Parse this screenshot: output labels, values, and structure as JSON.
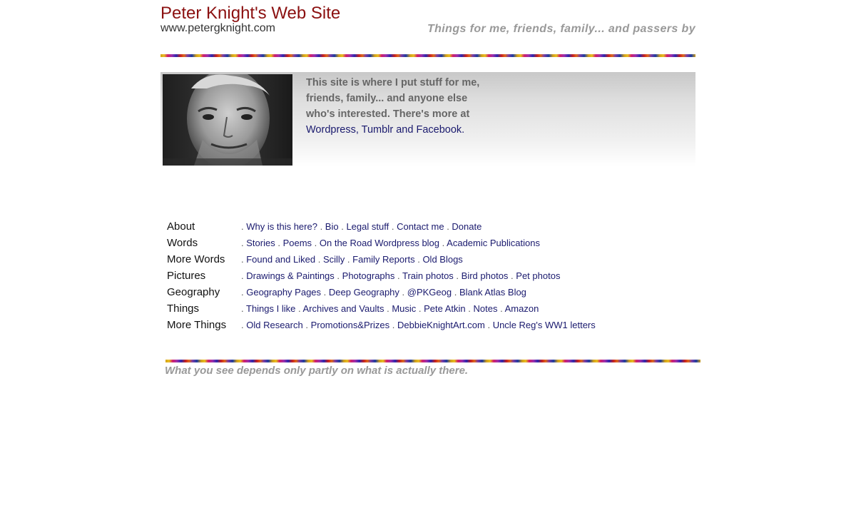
{
  "header": {
    "title": "Peter Knight's Web Site",
    "url": "www.petergknight.com",
    "tagline": "Things for me, friends, family... and passers by"
  },
  "intro": {
    "text": "This site is where I put stuff for me, friends, family... and anyone else who's interested. There's more at",
    "links": [
      "Wordpress",
      "Tumblr",
      "Facebook"
    ],
    "sep_comma": ", ",
    "sep_and": " and ",
    "end": "."
  },
  "nav": {
    "rows": [
      {
        "category": "About",
        "links": [
          "Why is this here?",
          "Bio",
          "Legal stuff",
          "Contact me",
          "Donate"
        ]
      },
      {
        "category": "Words",
        "links": [
          "Stories",
          "Poems",
          "On the Road Wordpress blog",
          "Academic Publications"
        ]
      },
      {
        "category": "More Words",
        "links": [
          "Found and Liked",
          "Scilly",
          "Family Reports",
          "Old Blogs"
        ]
      },
      {
        "category": "Pictures",
        "links": [
          "Drawings & Paintings",
          "Photographs",
          "Train photos",
          "Bird photos",
          "Pet photos"
        ]
      },
      {
        "category": "Geography",
        "links": [
          "Geography Pages",
          "Deep Geography",
          "@PKGeog",
          "Blank Atlas Blog"
        ]
      },
      {
        "category": "Things",
        "links": [
          "Things I like",
          "Archives and Vaults",
          "Music",
          "Pete Atkin",
          "Notes",
          "Amazon"
        ]
      },
      {
        "category": "More Things",
        "links": [
          "Old Research",
          "Promotions&Prizes",
          "DebbieKnightArt.com",
          "Uncle Reg's WW1 letters"
        ]
      }
    ],
    "separator": ". "
  },
  "footer": {
    "quote": "What you see depends only partly on what is actually there."
  },
  "colors": {
    "title": "#8b1010",
    "link": "#1a1a6e",
    "muted": "#999999"
  }
}
